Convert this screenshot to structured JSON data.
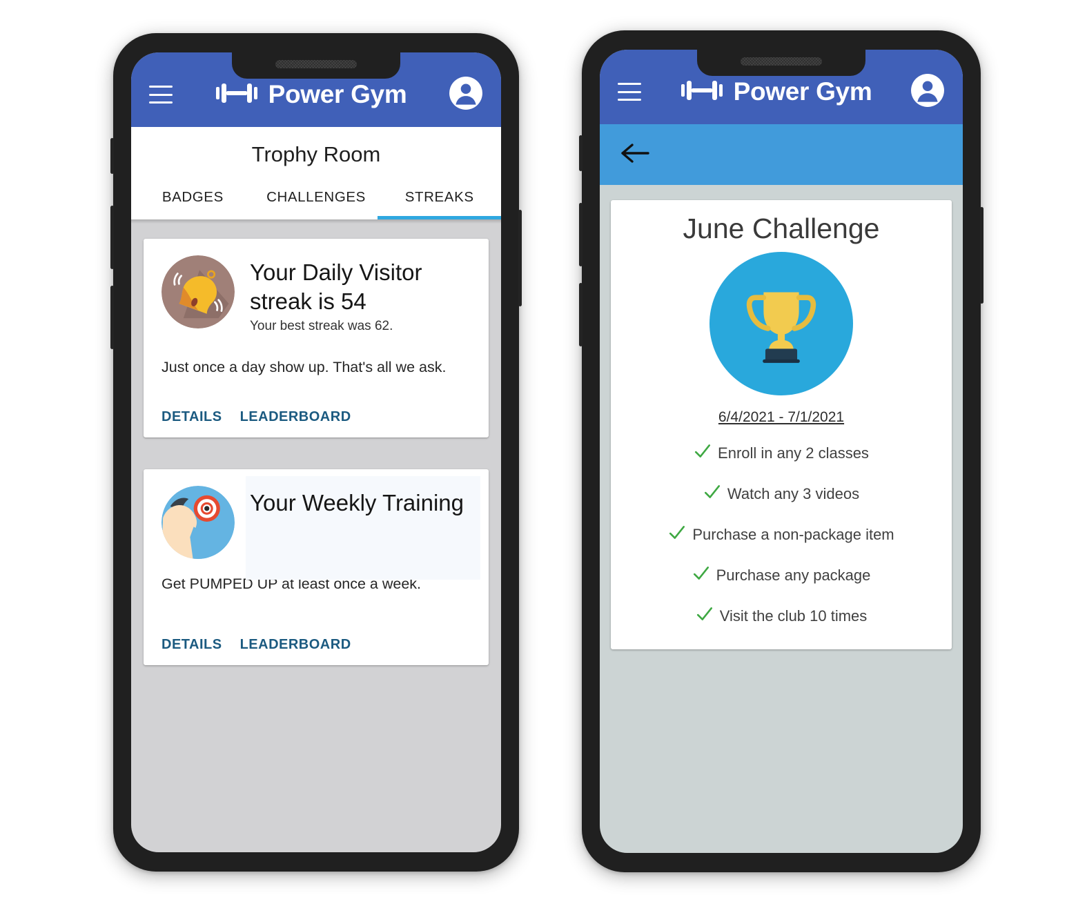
{
  "colors": {
    "appbar": "#4060b8",
    "subbar": "#419bdb",
    "tab_indicator": "#2fa8e0",
    "link": "#1b5a80",
    "check_green": "#3ea842",
    "trophy_circle": "#29a8dc",
    "page_bg_left": "#d2d2d4",
    "page_bg_right": "#ccd4d4"
  },
  "app": {
    "brand": "Power Gym",
    "menu_icon": "hamburger-icon",
    "logo_icon": "dumbbell-icon",
    "account_icon": "account-circle-icon"
  },
  "left_phone": {
    "page_title": "Trophy Room",
    "tabs": [
      {
        "label": "BADGES",
        "active": false
      },
      {
        "label": "CHALLENGES",
        "active": false
      },
      {
        "label": "STREAKS",
        "active": true
      }
    ],
    "cards": [
      {
        "icon": "bell-icon",
        "title": "Your Daily Visitor streak is 54",
        "subtitle": "Your best streak was 62.",
        "body": "Just once a day show up. That's all we ask.",
        "actions": [
          "DETAILS",
          "LEADERBOARD"
        ]
      },
      {
        "icon": "flexing-arm-icon",
        "title": "Your Weekly Training",
        "subtitle": "",
        "body": "Get PUMPED UP at least once a week.",
        "actions": [
          "DETAILS",
          "LEADERBOARD"
        ]
      }
    ]
  },
  "right_phone": {
    "back_icon": "arrow-left-icon",
    "challenge": {
      "title": "June Challenge",
      "badge_icon": "trophy-icon",
      "date_range": "6/4/2021 - 7/1/2021",
      "tasks": [
        {
          "label": "Enroll in any 2 classes",
          "complete": true
        },
        {
          "label": "Watch any 3 videos",
          "complete": true
        },
        {
          "label": "Purchase a non-package item",
          "complete": true
        },
        {
          "label": "Purchase any package",
          "complete": true
        },
        {
          "label": "Visit the club 10 times",
          "complete": true
        }
      ]
    }
  }
}
